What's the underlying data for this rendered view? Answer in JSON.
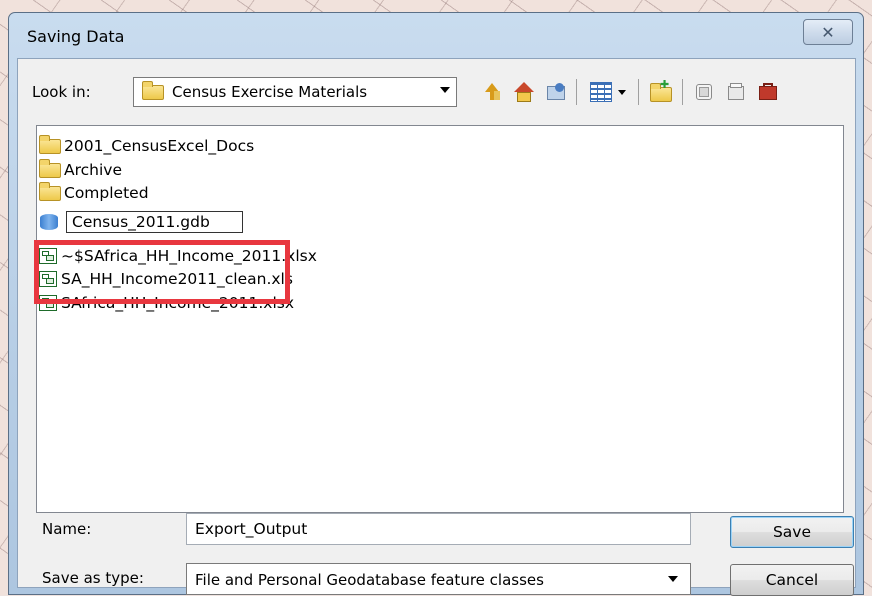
{
  "window": {
    "title": "Saving Data",
    "close_glyph": "✕"
  },
  "look_in": {
    "label": "Look in:",
    "value": "Census Exercise Materials"
  },
  "toolbar": {
    "icons": [
      "up-one-level-icon",
      "home-icon",
      "connect-folder-icon",
      "list-view-icon",
      "new-folder-icon",
      "database-icon",
      "toolbox-icon",
      "red-toolbox-icon"
    ]
  },
  "files": [
    {
      "name": "2001_CensusExcel_Docs",
      "type": "folder"
    },
    {
      "name": "Archive",
      "type": "folder"
    },
    {
      "name": "Completed",
      "type": "folder"
    },
    {
      "name": "Census_2011.gdb",
      "type": "geodatabase",
      "renaming": true
    },
    {
      "name": "~$SAfrica_HH_Income_2011.xlsx",
      "type": "excel"
    },
    {
      "name": "SA_HH_Income2011_clean.xls",
      "type": "excel"
    },
    {
      "name": "SAfrica_HH_Income_2011.xlsx",
      "type": "excel"
    }
  ],
  "name_field": {
    "label": "Name:",
    "value": "Export_Output"
  },
  "save_as_type": {
    "label": "Save as type:",
    "value": "File and Personal Geodatabase feature classes"
  },
  "buttons": {
    "save": "Save",
    "cancel": "Cancel"
  },
  "colors": {
    "highlight": "#e8373f",
    "title_bar": "#bcd2e8"
  }
}
